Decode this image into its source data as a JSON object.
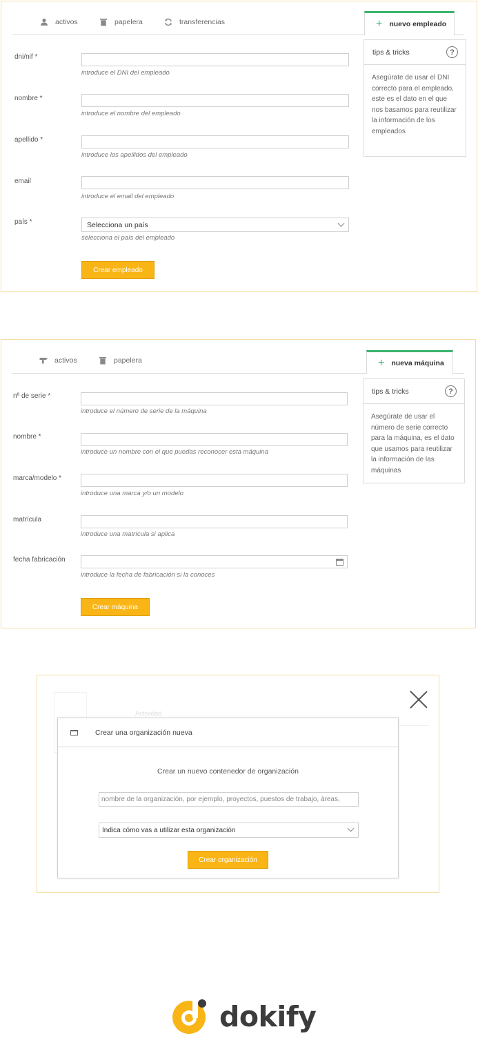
{
  "colors": {
    "accent": "#f9b515",
    "tab_active": "#3bb36e",
    "panel_border": "#f6dca2"
  },
  "employees": {
    "tabs": [
      {
        "label": "activos",
        "icon": "person-icon"
      },
      {
        "label": "papelera",
        "icon": "trash-icon"
      },
      {
        "label": "transferencias",
        "icon": "refresh-icon"
      }
    ],
    "active_tab": "nuevo empleado",
    "tips": {
      "title": "tips & tricks",
      "text": "Asegúrate de usar el DNI correcto para el empleado, este es el dato en el que nos basamos para reutilizar la información de los empleados"
    },
    "fields": [
      {
        "label": "dni/nif *",
        "hint": "introduce el DNI del empleado",
        "value": ""
      },
      {
        "label": "nombre *",
        "hint": "introduce el nombre del empleado",
        "value": ""
      },
      {
        "label": "apellido *",
        "hint": "introduce los apellidos del empleado",
        "value": ""
      },
      {
        "label": "email",
        "hint": "introduce el email del empleado",
        "value": ""
      },
      {
        "label": "país *",
        "hint": "selecciona el país del empleado",
        "value": "Selecciona un país"
      }
    ],
    "submit": "Crear empleado"
  },
  "machines": {
    "tabs": [
      {
        "label": "activos",
        "icon": "drill-icon"
      },
      {
        "label": "papelera",
        "icon": "trash-icon"
      }
    ],
    "active_tab": "nueva máquina",
    "tips": {
      "title": "tips & tricks",
      "text": "Asegúrate de usar el número de serie correcto para la máquina, es el dato que usamos para reutilizar la información de las máquinas"
    },
    "fields": [
      {
        "label": "nº de serie *",
        "hint": "introduce el número de serie de la máquina",
        "value": ""
      },
      {
        "label": "nombre *",
        "hint": "introduce un nombre con el que puedas reconocer esta máquina",
        "value": ""
      },
      {
        "label": "marca/modelo *",
        "hint": "introduce una marca y/o un modelo",
        "value": ""
      },
      {
        "label": "matrícula",
        "hint": "introduce una matrícula si aplica",
        "value": ""
      },
      {
        "label": "fecha fabricación",
        "hint": "introduce la fecha de fabricación si la conoces",
        "value": ""
      }
    ],
    "submit": "Crear máquina"
  },
  "organization_modal": {
    "background_label": "Actividad",
    "title": "Crear una organización nueva",
    "subtitle": "Crear un nuevo contenedor de organización",
    "name_placeholder": "nombre de la organización, por ejemplo, proyectos, puestos de trabajo, áreas,",
    "usage_select": "Indica cómo vas a utilizar esta organización",
    "submit": "Crear organización"
  },
  "brand": {
    "name": "dokify"
  }
}
